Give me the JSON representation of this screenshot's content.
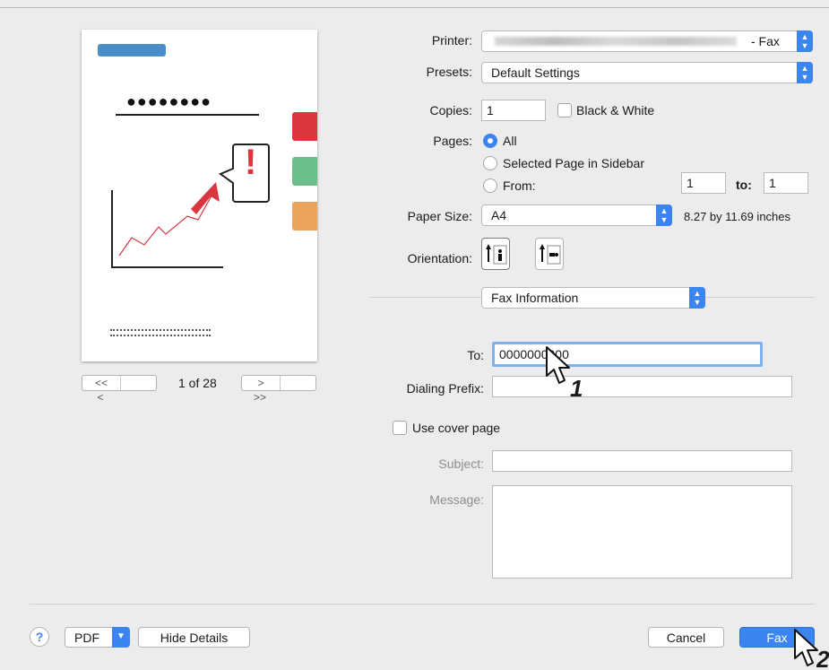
{
  "printer": {
    "label": "Printer:",
    "value": "- Fax"
  },
  "presets": {
    "label": "Presets:",
    "value": "Default Settings"
  },
  "copies": {
    "label": "Copies:",
    "value": "1",
    "bw_label": "Black & White"
  },
  "pages": {
    "label": "Pages:",
    "all": "All",
    "selected": "Selected Page in Sidebar",
    "from_label": "From:",
    "from_value": "1",
    "to_label": "to:",
    "to_value": "1"
  },
  "paper": {
    "label": "Paper Size:",
    "value": "A4",
    "dims": "8.27 by 11.69 inches"
  },
  "orientation": {
    "label": "Orientation:"
  },
  "section": {
    "value": "Fax Information"
  },
  "fax": {
    "to_label": "To:",
    "to_value": "0000000000",
    "prefix_label": "Dialing Prefix:",
    "prefix_value": "",
    "cover_label": "Use cover page",
    "subject_label": "Subject:",
    "subject_value": "",
    "message_label": "Message:",
    "message_value": ""
  },
  "preview": {
    "page_info": "1 of 28",
    "first": "<<",
    "prev": "<",
    "next": ">",
    "last": ">>",
    "title_dots": "●●●●●●●●",
    "exclaim": "!"
  },
  "footer": {
    "help": "?",
    "pdf": "PDF",
    "hide_details": "Hide Details",
    "cancel": "Cancel",
    "fax": "Fax"
  },
  "callouts": {
    "one": "1",
    "two": "2"
  },
  "colors": {
    "accent": "#3c85f0",
    "tab_red": "#d9363e",
    "tab_green": "#6cbf8a",
    "tab_orange": "#eba45e",
    "chart_arrow": "#d9363e"
  }
}
